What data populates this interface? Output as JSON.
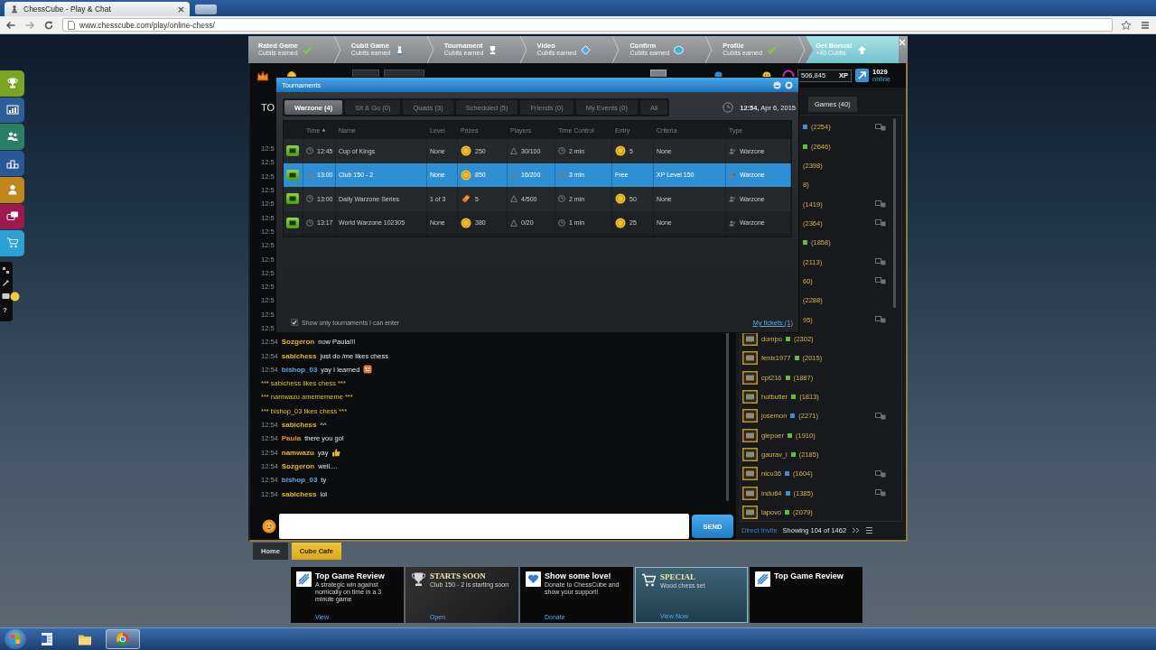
{
  "browser": {
    "tab_title": "ChessCube - Play & Chat",
    "url": "www.chesscube.com/play/online-chess/"
  },
  "left_dock": {
    "buttons": [
      {
        "kind": "trophy",
        "color": "#7aa424"
      },
      {
        "kind": "chart",
        "color": "#2d5e96"
      },
      {
        "kind": "people",
        "color": "#2a7f66"
      },
      {
        "kind": "podium",
        "color": "#2a5894"
      },
      {
        "kind": "person",
        "color": "#c0861e"
      },
      {
        "kind": "chat",
        "color": "#9c1a4e"
      },
      {
        "kind": "cart",
        "color": "#2aa2d6"
      }
    ],
    "help": "?"
  },
  "steps": [
    {
      "title": "Rated Game",
      "subtitle": "Cubits earned",
      "kind": "check",
      "active": false
    },
    {
      "title": "Cubit Game",
      "subtitle": "Cubits earned",
      "kind": "pawn",
      "active": false
    },
    {
      "title": "Tournament",
      "subtitle": "Cubits earned",
      "kind": "trophy",
      "active": false
    },
    {
      "title": "Video",
      "subtitle": "Cubits earned",
      "kind": "tag",
      "active": false
    },
    {
      "title": "Confirm",
      "subtitle": "Cubits earned",
      "kind": "cube",
      "active": false
    },
    {
      "title": "Profile",
      "subtitle": "Cubits earned",
      "kind": "check",
      "active": false
    },
    {
      "title": "Get Bonus!",
      "subtitle": "+40 Cubits",
      "kind": "up",
      "active": true
    }
  ],
  "account": {
    "xp_value": "506,845",
    "xp_label": "XP",
    "online_count": "1029",
    "online_label": "online"
  },
  "chat": {
    "heading": "TO",
    "earlier_times": [
      "12:5",
      "12:5",
      "12:5",
      "12:5",
      "12:5",
      "12:5",
      "12:5",
      "12:5",
      "12:5",
      "12:5",
      "12:5",
      "12:5",
      "12:5",
      "12:5"
    ],
    "messages": [
      {
        "kind": "message",
        "time": "12:54",
        "user": "Sozgeron",
        "color": "#e3b92e",
        "text": "now Paula!!!"
      },
      {
        "kind": "message",
        "time": "12:54",
        "user": "sabichess",
        "color": "#e3b92e",
        "text": "just do /me likes chess"
      },
      {
        "kind": "message",
        "time": "12:54",
        "user": "bishop_03",
        "color": "#5aa7e0",
        "text": "yay I learned",
        "emoji": {
          "kind": "face"
        }
      },
      {
        "kind": "action",
        "text": "*** sabichess likes chess ***"
      },
      {
        "kind": "action",
        "text": "*** namwazu amemememe ***"
      },
      {
        "kind": "action",
        "text": "*** bishop_03 likes chess ***"
      },
      {
        "kind": "message",
        "time": "12:54",
        "user": "sabichess",
        "color": "#e3b92e",
        "text": "^^"
      },
      {
        "kind": "message",
        "time": "12:54",
        "user": "Paula",
        "color": "#e3932e",
        "text": "there you go!"
      },
      {
        "kind": "message",
        "time": "12:54",
        "user": "namwazu",
        "color": "#e3b92e",
        "text": "yay",
        "emoji": {
          "kind": "thumb"
        }
      },
      {
        "kind": "message",
        "time": "12:54",
        "user": "Sozgeron",
        "color": "#e3b92e",
        "text": "well...."
      },
      {
        "kind": "message",
        "time": "12:54",
        "user": "bishop_03",
        "color": "#5aa7e0",
        "text": "ty"
      },
      {
        "kind": "message",
        "time": "12:54",
        "user": "sabichess",
        "color": "#e3b92e",
        "text": "lol"
      }
    ],
    "send": "SEND"
  },
  "dialog": {
    "title": "Tournaments",
    "tabs": [
      {
        "label": "Warzone (4)",
        "selected": true
      },
      {
        "label": "Sit & Go (0)",
        "selected": false
      },
      {
        "label": "Quads (3)",
        "selected": false
      },
      {
        "label": "Scheduled (5)",
        "selected": false
      },
      {
        "label": "Friends (0)",
        "selected": false
      },
      {
        "label": "My Events (0)",
        "selected": false
      },
      {
        "label": "All",
        "selected": false
      }
    ],
    "clock": "**12:54,** Apr 6, 2015",
    "columns": [
      {
        "label": "Time",
        "sorted": true
      },
      {
        "label": "Name",
        "sorted": false
      },
      {
        "label": "Level",
        "sorted": false
      },
      {
        "label": "Prizes",
        "sorted": false
      },
      {
        "label": "Players",
        "sorted": false
      },
      {
        "label": "Time Control",
        "sorted": false
      },
      {
        "label": "Entry",
        "sorted": false
      },
      {
        "label": "Criteria",
        "sorted": false
      },
      {
        "label": "Type",
        "sorted": false
      }
    ],
    "rows": [
      {
        "time": "12:45",
        "name": "Cup of Kings",
        "level": "None",
        "prize": {
          "amount": "250",
          "kind": "coin"
        },
        "players": "30/100",
        "time_control": "2 min",
        "entry": {
          "amount": "5",
          "kind": "coin"
        },
        "criteria": "None",
        "type": "Warzone",
        "selected": false
      },
      {
        "time": "13:00",
        "name": "Club 150 - 2",
        "level": "None",
        "prize": {
          "amount": "850",
          "kind": "coin"
        },
        "players": "16/200",
        "time_control": "3 min",
        "entry": {
          "amount": "Free",
          "kind": "plain"
        },
        "criteria": "XP Level 150",
        "type": "Warzone",
        "selected": true
      },
      {
        "time": "13:00",
        "name": "Daily Warzone Series",
        "level": "1 of 3",
        "prize": {
          "amount": "5",
          "kind": "ticket"
        },
        "players": "4/500",
        "time_control": "2 min",
        "entry": {
          "amount": "50",
          "kind": "coin"
        },
        "criteria": "None",
        "type": "Warzone",
        "selected": false
      },
      {
        "time": "13:17",
        "name": "World Warzone 102305",
        "level": "None",
        "prize": {
          "amount": "380",
          "kind": "coin"
        },
        "players": "0/20",
        "time_control": "1 min",
        "entry": {
          "amount": "25",
          "kind": "coin"
        },
        "criteria": "None",
        "type": "Warzone",
        "selected": false
      }
    ],
    "filter": {
      "label": "Show only tournaments I can enter",
      "checked": true
    },
    "tickets_link": "My tickets (1)"
  },
  "players": {
    "tab": "Games (40)",
    "rows": [
      {
        "rating": "(2254)",
        "color": "#3b8fd8",
        "playing": true
      },
      {
        "rating": "(2646)",
        "color": "#5bbf3a",
        "playing": false
      },
      {
        "rating": "(2398)",
        "playing": false
      },
      {
        "rating": "8)",
        "playing": false
      },
      {
        "rating": "(1419)",
        "playing": true
      },
      {
        "rating": "(2364)",
        "playing": true
      },
      {
        "rating": "(1858)",
        "color": "#5bbf3a",
        "playing": false
      },
      {
        "rating": "(2113)",
        "playing": true
      },
      {
        "rating": "60)",
        "playing": true
      },
      {
        "rating": "(2288)",
        "playing": false
      },
      {
        "rating": "95)",
        "playing": true
      },
      {
        "name": "dompo",
        "color": "#5bbf3a",
        "rating": "(2302)",
        "playing": false
      },
      {
        "name": "fenix1977",
        "color": "#5bbf3a",
        "rating": "(2015)",
        "playing": false
      },
      {
        "name": "cpt216",
        "color": "#5bbf3a",
        "rating": "(1887)",
        "playing": false
      },
      {
        "name": "hotbutler",
        "color": "#5bbf3a",
        "rating": "(1813)",
        "playing": false
      },
      {
        "name": "josemon",
        "color": "#3b8fd8",
        "rating": "(2271)",
        "playing": true
      },
      {
        "name": "glepoer",
        "color": "#5bbf3a",
        "rating": "(1910)",
        "playing": false
      },
      {
        "name": "gaurav_i",
        "color": "#5bbf3a",
        "rating": "(2185)",
        "playing": false
      },
      {
        "name": "nicu36",
        "color": "#3b8fd8",
        "rating": "(1604)",
        "playing": true
      },
      {
        "name": "indu64",
        "color": "#3b8fd8",
        "rating": "(1385)",
        "playing": true
      },
      {
        "name": "lapovo",
        "color": "#5bbf3a",
        "rating": "(2079)",
        "playing": false
      }
    ],
    "direct_invite": "Direct Invite",
    "showing": "Showing 104 of 1462"
  },
  "page_tabs": [
    {
      "label": "Home",
      "selected": false
    },
    {
      "label": "Cube Cafe",
      "selected": true
    }
  ],
  "banners": [
    {
      "kind": "review",
      "title": "Top Game Review",
      "text": "A strategic win against nomically on time in a 3 minute game",
      "link": "View"
    },
    {
      "kind": "tournament",
      "title": "STARTS SOON",
      "text": "Club 150 - 2 is starting soon",
      "link": "Open"
    },
    {
      "kind": "donate",
      "title": "Show some love!",
      "text": "Donate to ChessCube and show your support!",
      "link": "Donate"
    },
    {
      "kind": "shop",
      "title": "SPECIAL",
      "text": "Wood chess set",
      "link": "View Now"
    },
    {
      "kind": "review",
      "title": "Top Game Review"
    }
  ],
  "taskbar": [
    {
      "kind": "document",
      "selected": false
    },
    {
      "kind": "folder",
      "selected": false
    },
    {
      "kind": "browser",
      "selected": true
    }
  ]
}
